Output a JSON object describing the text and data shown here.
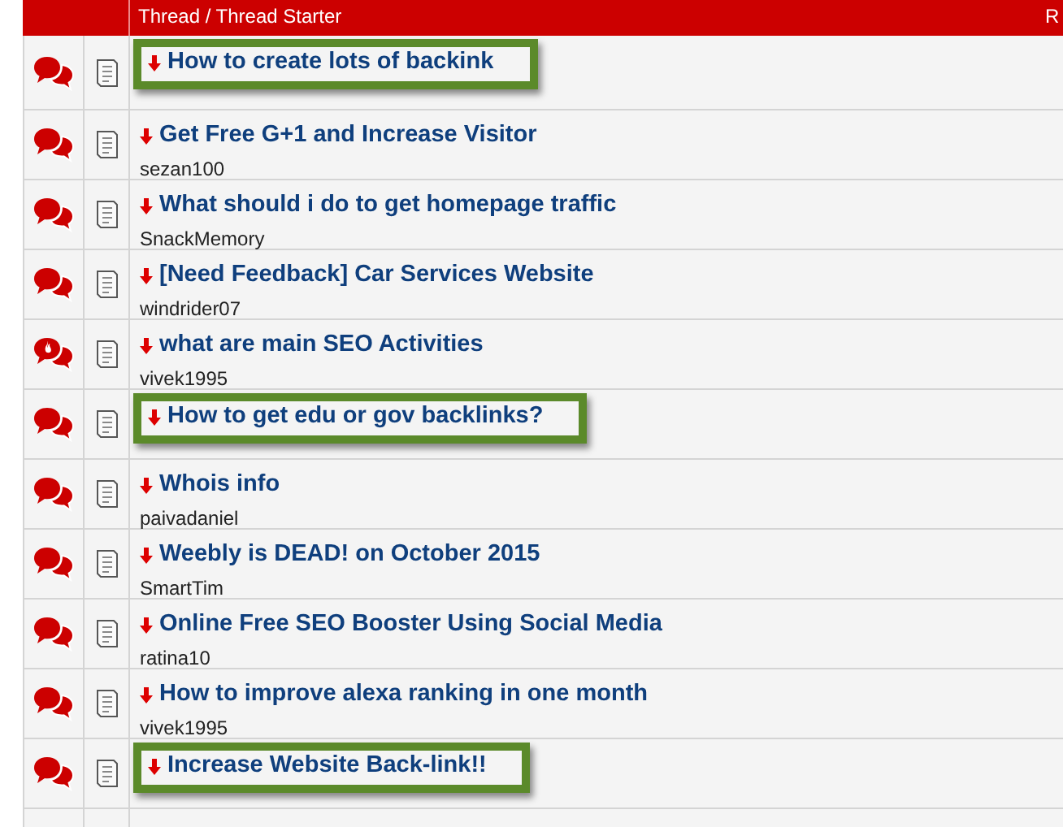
{
  "table": {
    "columns": [
      {
        "label": "Thread / Thread Starter"
      },
      {
        "label": "R"
      }
    ],
    "rows": [
      {
        "title": "How to create lots of backink",
        "highlighted": true,
        "hot": false
      },
      {
        "title": "Get Free G+1 and Increase Visitor",
        "starter": "sezan100",
        "highlighted": false,
        "hot": false
      },
      {
        "title": "What should i do to get homepage traffic",
        "starter": "SnackMemory",
        "highlighted": false,
        "hot": false
      },
      {
        "title": "[Need Feedback] Car Services Website",
        "starter": "windrider07",
        "highlighted": false,
        "hot": false
      },
      {
        "title": "what are main SEO Activities",
        "starter": "vivek1995",
        "highlighted": false,
        "hot": true
      },
      {
        "title": "How to get edu or gov backlinks?",
        "highlighted": true,
        "hot": false
      },
      {
        "title": "Whois info",
        "starter": "paivadaniel",
        "highlighted": false,
        "hot": false
      },
      {
        "title": "Weebly is DEAD! on October 2015",
        "starter": "SmartTim",
        "highlighted": false,
        "hot": false
      },
      {
        "title": "Online Free SEO Booster Using Social Media",
        "starter": "ratina10",
        "highlighted": false,
        "hot": false
      },
      {
        "title": "How to improve alexa ranking in one month",
        "starter": "vivek1995",
        "highlighted": false,
        "hot": false
      },
      {
        "title": "Increase Website Back-link!!",
        "highlighted": true,
        "hot": false
      }
    ]
  }
}
